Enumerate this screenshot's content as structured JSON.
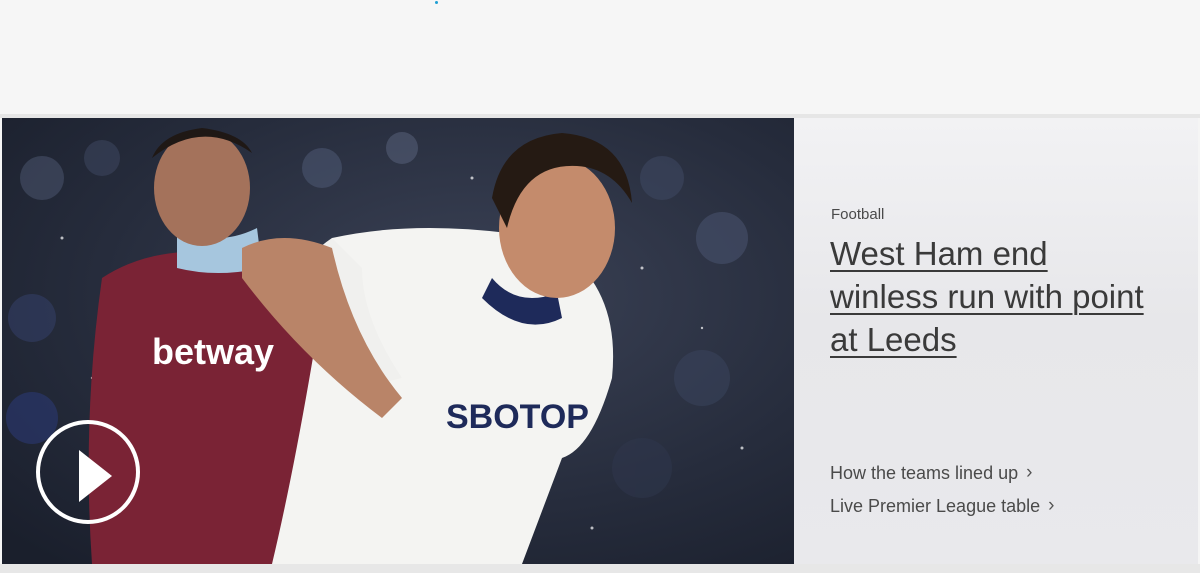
{
  "hero": {
    "category": "Football",
    "headline": "West Ham end winless run with point at Leeds",
    "links": [
      {
        "label": "How the teams lined up",
        "icon": "chevron-right-icon"
      },
      {
        "label": "Live Premier League table",
        "icon": "chevron-right-icon"
      }
    ],
    "media": {
      "shirt_sponsor_left": "betway",
      "shirt_sponsor_right": "SBOTOP",
      "play_icon": "play-icon"
    }
  },
  "colors": {
    "accent_dot": "#1f9fd3",
    "claret": "#7a2335",
    "white_kit": "#ffffff"
  }
}
